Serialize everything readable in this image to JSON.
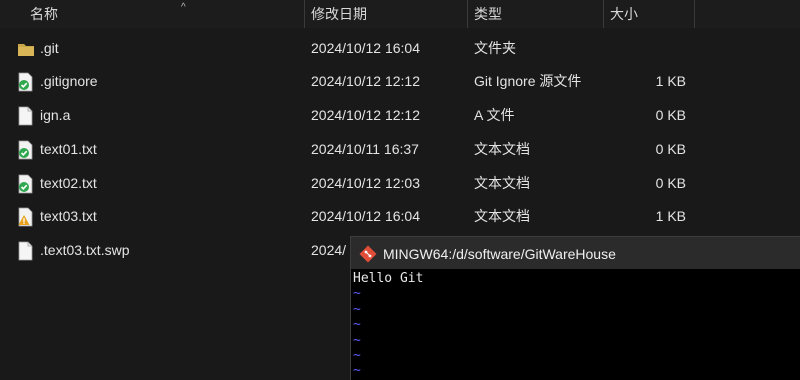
{
  "columns": {
    "name": "名称",
    "date": "修改日期",
    "type": "类型",
    "size": "大小"
  },
  "files": [
    {
      "name": ".git",
      "date": "2024/10/12 16:04",
      "type": "文件夹",
      "size": "",
      "icon": "folder-icon"
    },
    {
      "name": ".gitignore",
      "date": "2024/10/12 12:12",
      "type": "Git Ignore 源文件",
      "size": "1 KB",
      "icon": "git-clean-file-icon"
    },
    {
      "name": "ign.a",
      "date": "2024/10/12 12:12",
      "type": "A 文件",
      "size": "0 KB",
      "icon": "file-icon"
    },
    {
      "name": "text01.txt",
      "date": "2024/10/11 16:37",
      "type": "文本文档",
      "size": "0 KB",
      "icon": "git-clean-file-icon"
    },
    {
      "name": "text02.txt",
      "date": "2024/10/12 12:03",
      "type": "文本文档",
      "size": "0 KB",
      "icon": "git-clean-file-icon"
    },
    {
      "name": "text03.txt",
      "date": "2024/10/12 16:04",
      "type": "文本文档",
      "size": "1 KB",
      "icon": "git-modified-file-icon"
    },
    {
      "name": ".text03.txt.swp",
      "date": "2024/",
      "type": "",
      "size": "",
      "icon": "file-icon"
    }
  ],
  "terminal": {
    "title": "MINGW64:/d/software/GitWareHouse",
    "lines": [
      "Hello Git",
      "~",
      "~",
      "~",
      "~",
      "~",
      "~"
    ]
  },
  "colors": {
    "folder": "#c9a649",
    "git_clean": "#2fa84f",
    "git_modified": "#e8a21a",
    "vim_tilde": "#5b5bf7"
  }
}
